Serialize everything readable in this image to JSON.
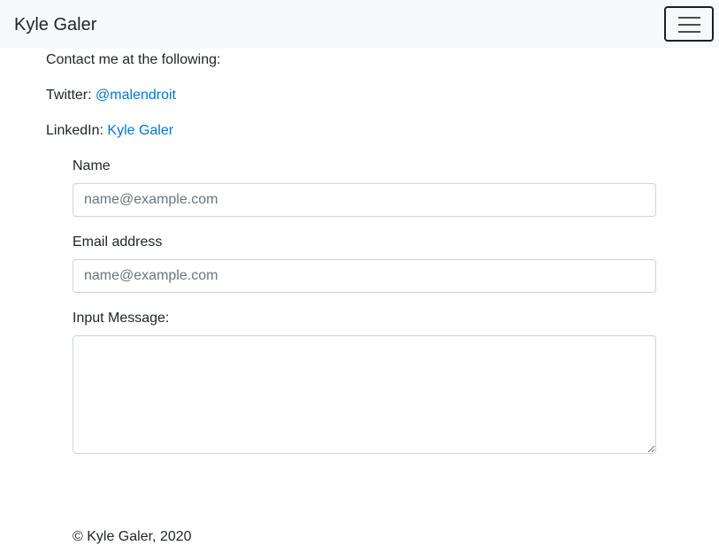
{
  "navbar": {
    "brand": "Kyle Galer",
    "toggler_icon": "hamburger-menu-icon"
  },
  "contact": {
    "intro": "Contact me at the following:",
    "twitter_label": "Twitter: ",
    "twitter_link": "@malendroit",
    "linkedin_label": "LinkedIn: ",
    "linkedin_link": "Kyle Galer"
  },
  "form": {
    "name_label": "Name",
    "name_placeholder": "name@example.com",
    "email_label": "Email address",
    "email_placeholder": "name@example.com",
    "message_label": "Input Message:",
    "message_value": ""
  },
  "footer": {
    "copyright": "© Kyle Galer, 2020"
  },
  "colors": {
    "navbar_bg": "#f8f9fa",
    "link": "#0275d8",
    "text": "#212529",
    "input_border": "#ced4da"
  }
}
